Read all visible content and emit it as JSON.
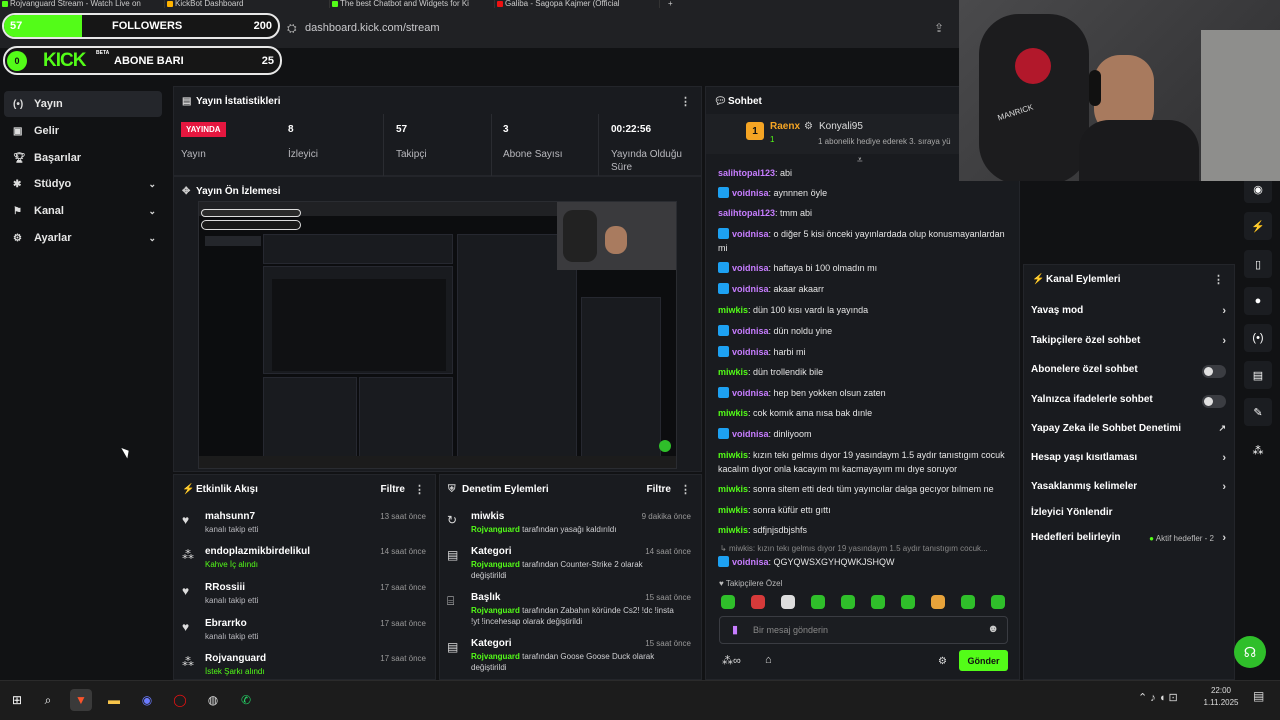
{
  "browser": {
    "tabs": [
      "Rojvanguard Stream - Watch Live on",
      "KickBot Dashboard",
      "The best Chatbot and Widgets for Ki",
      "Galiba - Sagopa Kajmer (Official"
    ],
    "new_tab": "+",
    "url": "dashboard.kick.com/stream"
  },
  "overlay": {
    "followers_label": "FOLLOWERS",
    "followers_current": "57",
    "followers_goal": "200",
    "followers_progress": 0.285,
    "sub_label": "ABONE BARI",
    "sub_current": "0",
    "sub_goal": "25",
    "sub_progress": 0.0,
    "logo": "KICK",
    "logo_tag": "BETA"
  },
  "sidebar": {
    "items": [
      {
        "label": "Yayın",
        "icon": "broadcast-icon"
      },
      {
        "label": "Gelir",
        "icon": "dollar-icon"
      },
      {
        "label": "Başarılar",
        "icon": "trophy-icon"
      },
      {
        "label": "Stüdyo",
        "icon": "studio-icon"
      },
      {
        "label": "Kanal",
        "icon": "channel-icon"
      },
      {
        "label": "Ayarlar",
        "icon": "gear-icon"
      }
    ]
  },
  "stats": {
    "title": "Yayın İstatistikleri",
    "live_badge": "YAYINDA",
    "status_label": "Yayın",
    "items": [
      {
        "value": "8",
        "label": "İzleyici"
      },
      {
        "value": "57",
        "label": "Takipçi"
      },
      {
        "value": "3",
        "label": "Abone Sayısı"
      },
      {
        "value": "00:22:56",
        "label": "Yayında Olduğu Süre"
      }
    ]
  },
  "preview": {
    "title": "Yayın Ön İzlemesi"
  },
  "events": {
    "title": "Etkinlik Akışı",
    "filter": "Filtre",
    "items": [
      {
        "name": "mahsunn7",
        "sub": "kanalı takip etti",
        "time": "13 saat önce"
      },
      {
        "name": "endoplazmikbirdelikul",
        "sub": "Kahve İç alındı",
        "time": "14 saat önce"
      },
      {
        "name": "RRossiii",
        "sub": "kanalı takip etti",
        "time": "17 saat önce"
      },
      {
        "name": "Ebrarrko",
        "sub": "kanalı takip etti",
        "time": "17 saat önce"
      },
      {
        "name": "Rojvanguard",
        "sub": "İstek Şarkı alındı",
        "time": "17 saat önce"
      }
    ]
  },
  "moderation": {
    "title": "Denetim Eylemleri",
    "filter": "Filtre",
    "items": [
      {
        "name": "miwkis",
        "actor": "Rojvanguard",
        "desc": "tarafından yasağı kaldırıldı",
        "time": "9 dakika önce"
      },
      {
        "name": "Kategori",
        "actor": "Rojvanguard",
        "desc": "tarafından Counter-Strike 2 olarak değiştirildi",
        "time": "14 saat önce"
      },
      {
        "name": "Başlık",
        "actor": "Rojvanguard",
        "desc": "tarafından Zabahın köründe Cs2! !dc !insta !yt !incehesap olarak değiştirildi",
        "time": "15 saat önce"
      },
      {
        "name": "Kategori",
        "actor": "Rojvanguard",
        "desc": "tarafından Goose Goose Duck olarak değiştirildi",
        "time": "15 saat önce"
      }
    ]
  },
  "chat": {
    "title": "Sohbet",
    "pinned_rank": "1",
    "pinned_user": "Raenx",
    "pinned_count": "1",
    "pinned_gifter": "Konyali95",
    "pinned_text": "1 abonelik hediye ederek 3. sıraya yü",
    "messages": [
      {
        "user": "salihtopal123",
        "text": "abi",
        "color": "#c77dff",
        "badge": false
      },
      {
        "user": "voidnisa",
        "text": "aynnnen öyle",
        "color": "#c77dff",
        "badge": true
      },
      {
        "user": "salihtopal123",
        "text": "tmm abi",
        "color": "#c77dff",
        "badge": false
      },
      {
        "user": "voidnisa",
        "text": "o diğer 5 kisi önceki yayınlardada olup konusmayanlardan mi",
        "color": "#c77dff",
        "badge": true
      },
      {
        "user": "voidnisa",
        "text": "haftaya bi 100 olmadın mı",
        "color": "#c77dff",
        "badge": true
      },
      {
        "user": "voidnisa",
        "text": "akaar akaarr",
        "color": "#c77dff",
        "badge": true
      },
      {
        "user": "miwkis",
        "text": "dün 100 kısı vardı la yayında",
        "color": "#53fc18",
        "badge": false
      },
      {
        "user": "voidnisa",
        "text": "dün noldu yine",
        "color": "#c77dff",
        "badge": true
      },
      {
        "user": "voidnisa",
        "text": "harbi mi",
        "color": "#c77dff",
        "badge": true
      },
      {
        "user": "miwkis",
        "text": "dün trollendik bile",
        "color": "#53fc18",
        "badge": false
      },
      {
        "user": "voidnisa",
        "text": "hep ben yokken olsun zaten",
        "color": "#c77dff",
        "badge": true
      },
      {
        "user": "miwkis",
        "text": "cok komık ama nısa bak dınle",
        "color": "#53fc18",
        "badge": false
      },
      {
        "user": "voidnisa",
        "text": "dinliyoom",
        "color": "#c77dff",
        "badge": true
      },
      {
        "user": "miwkis",
        "text": "kızın tekı gelmıs dıyor 19 yasındaym 1.5 aydır tanıstıgım cocuk kacalım dıyor onla kacayım mı kacmayayım mı dıye soruyor",
        "color": "#53fc18",
        "badge": false
      },
      {
        "user": "miwkis",
        "text": "sonra sitem etti dedı tüm yayıncılar dalga gecıyor bılmem ne",
        "color": "#53fc18",
        "badge": false
      },
      {
        "user": "miwkis",
        "text": "sonra küfür ettı gıttı",
        "color": "#53fc18",
        "badge": false
      },
      {
        "user": "miwkis",
        "text": "sdfjnjsdbjshfs",
        "color": "#53fc18",
        "badge": false
      }
    ],
    "reply_ref": "miwkis: kızın tekı gelmıs dıyor 19 yasındaym 1.5 aydır tanıstıgım cocuk...",
    "reply_user": "voidnisa",
    "reply_text": "QGYQWSXGYHQWKJSHQW",
    "followers_only": "Takipçilere Özel",
    "input_placeholder": "Bir mesaj gönderin",
    "send": "Gönder"
  },
  "actions": {
    "title": "Kanal Eylemleri",
    "items": [
      {
        "label": "Yavaş mod",
        "control": "arrow"
      },
      {
        "label": "Takipçilere özel sohbet",
        "control": "arrow"
      },
      {
        "label": "Abonelere özel sohbet",
        "control": "toggle"
      },
      {
        "label": "Yalnızca ifadelerle sohbet",
        "control": "toggle"
      },
      {
        "label": "Yapay Zeka ile Sohbet Denetimi",
        "control": "external"
      },
      {
        "label": "Hesap yaşı kısıtlaması",
        "control": "arrow"
      },
      {
        "label": "Yasaklanmış kelimeler",
        "control": "arrow"
      },
      {
        "label": "İzleyici Yönlendir",
        "control": "none"
      },
      {
        "label": "Hedefleri belirleyin",
        "control": "arrow"
      }
    ],
    "goal_status": "Aktif hedefler - 2"
  },
  "taskbar": {
    "time": "22:00",
    "date": "1.11.2025"
  },
  "webcam": {
    "watermark": "MANRICK"
  },
  "colors": {
    "kick_green": "#53fc18",
    "live_red": "#e5173f",
    "purple_user": "#c77dff"
  }
}
